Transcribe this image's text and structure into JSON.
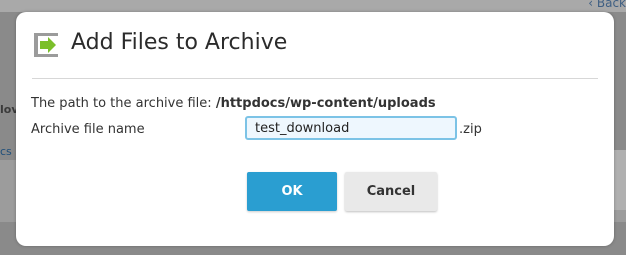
{
  "background": {
    "back_link": "‹ Back",
    "left_fragment_1": "lov",
    "left_fragment_2": "cs"
  },
  "dialog": {
    "title": "Add Files to Archive",
    "icon": "archive-add-icon",
    "path_label": "The path to the archive file:",
    "path_value": "/httpdocs/wp-content/uploads",
    "name_label": "Archive file name",
    "name_value": "test_download",
    "extension": ".zip",
    "ok_label": "OK",
    "cancel_label": "Cancel"
  },
  "colors": {
    "accent": "#2a9ed1",
    "icon_green": "#7bbf2a",
    "input_border": "#7cc3e6"
  }
}
